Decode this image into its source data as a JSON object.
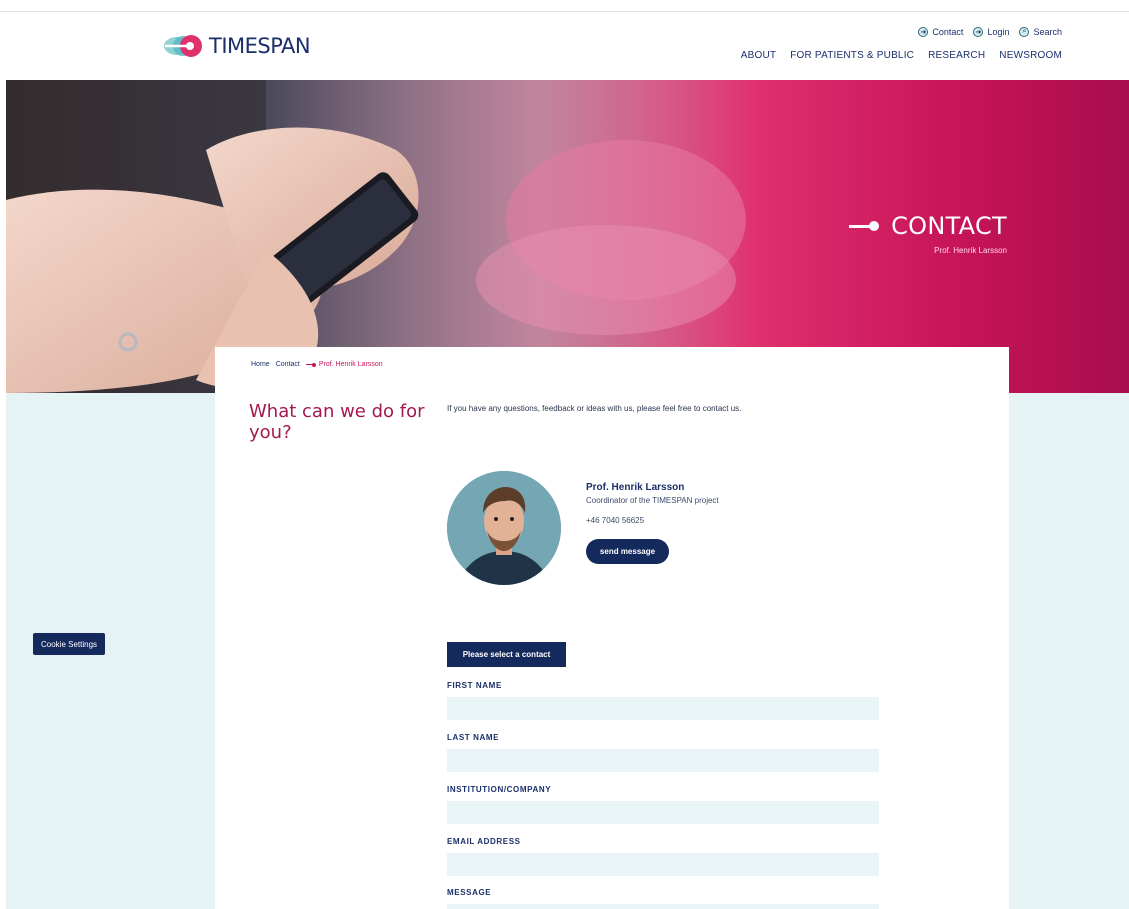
{
  "header": {
    "logo_text": "TIMESPAN",
    "utility_nav": [
      {
        "label": "Contact",
        "icon": "arrow-circle-icon"
      },
      {
        "label": "Login",
        "icon": "login-arrow-icon"
      },
      {
        "label": "Search",
        "icon": "search-icon"
      }
    ],
    "main_nav": [
      "ABOUT",
      "FOR PATIENTS & PUBLIC",
      "RESEARCH",
      "NEWSROOM"
    ]
  },
  "hero": {
    "title": "CONTACT",
    "subtitle": "Prof. Henrik Larsson"
  },
  "breadcrumb": {
    "items": [
      "Home",
      "Contact"
    ],
    "current": "Prof. Henrik Larsson"
  },
  "section": {
    "title": "What can we do for you?",
    "intro": "If you have any questions, feedback or ideas with us, please feel free to contact us."
  },
  "contact": {
    "name": "Prof. Henrik Larsson",
    "role": "Coordinator of the TIMESPAN project",
    "phone": "+46 7040 56625",
    "send_label": "send message"
  },
  "cookie": {
    "label": "Cookie Settings"
  },
  "form": {
    "select_label": "Please select a contact",
    "fields": [
      {
        "label": "FIRST NAME",
        "value": ""
      },
      {
        "label": "LAST NAME",
        "value": ""
      },
      {
        "label": "INSTITUTION/COMPANY",
        "value": ""
      },
      {
        "label": "EMAIL ADDRESS",
        "value": ""
      },
      {
        "label": "MESSAGE",
        "value": ""
      }
    ]
  },
  "colors": {
    "brand_navy": "#152a5c",
    "brand_magenta": "#c7175d",
    "field_bg": "#e8f4f5",
    "page_bg": "#e5f3f4"
  }
}
